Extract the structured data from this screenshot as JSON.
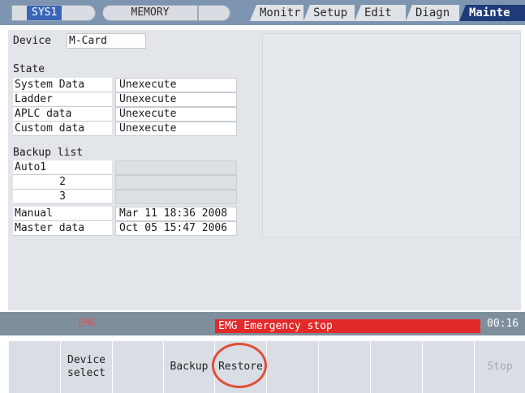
{
  "header": {
    "system": "SYS1",
    "mode": "MEMORY",
    "tabs": [
      {
        "label": "Monitr",
        "active": false
      },
      {
        "label": "Setup",
        "active": false
      },
      {
        "label": "Edit",
        "active": false
      },
      {
        "label": "Diagn",
        "active": false
      },
      {
        "label": "Mainte",
        "active": true
      }
    ]
  },
  "device": {
    "label": "Device",
    "value": "M-Card"
  },
  "state": {
    "heading": "State",
    "rows": [
      {
        "label": "System Data",
        "value": "Unexecute"
      },
      {
        "label": "Ladder",
        "value": "Unexecute"
      },
      {
        "label": "APLC data",
        "value": "Unexecute"
      },
      {
        "label": "Custom data",
        "value": "Unexecute"
      }
    ]
  },
  "backup": {
    "heading": "Backup list",
    "rows": [
      {
        "label": "Auto1",
        "value": ""
      },
      {
        "label": "2",
        "value": ""
      },
      {
        "label": "3",
        "value": ""
      },
      {
        "label": "Manual",
        "value": "Mar 11 18:36 2008"
      },
      {
        "label": "Master data",
        "value": "Oct 05 15:47 2006"
      }
    ]
  },
  "status": {
    "emg_indicator": "EMG",
    "alarm": "EMG  Emergency stop",
    "time": "00:16",
    "colors": {
      "alarm": "#e22a2a",
      "highlight_ring": "#e24d3a",
      "active_tab": "#1e3a7a"
    }
  },
  "function_keys": [
    {
      "label": "",
      "enabled": true
    },
    {
      "label": "Device select",
      "line1": "Device",
      "line2": "select",
      "enabled": true
    },
    {
      "label": "",
      "enabled": true
    },
    {
      "label": "Backup",
      "enabled": true
    },
    {
      "label": "Restore",
      "enabled": true,
      "highlighted": true
    },
    {
      "label": "",
      "enabled": true
    },
    {
      "label": "",
      "enabled": true
    },
    {
      "label": "",
      "enabled": true
    },
    {
      "label": "",
      "enabled": true
    },
    {
      "label": "Stop",
      "enabled": false
    }
  ]
}
